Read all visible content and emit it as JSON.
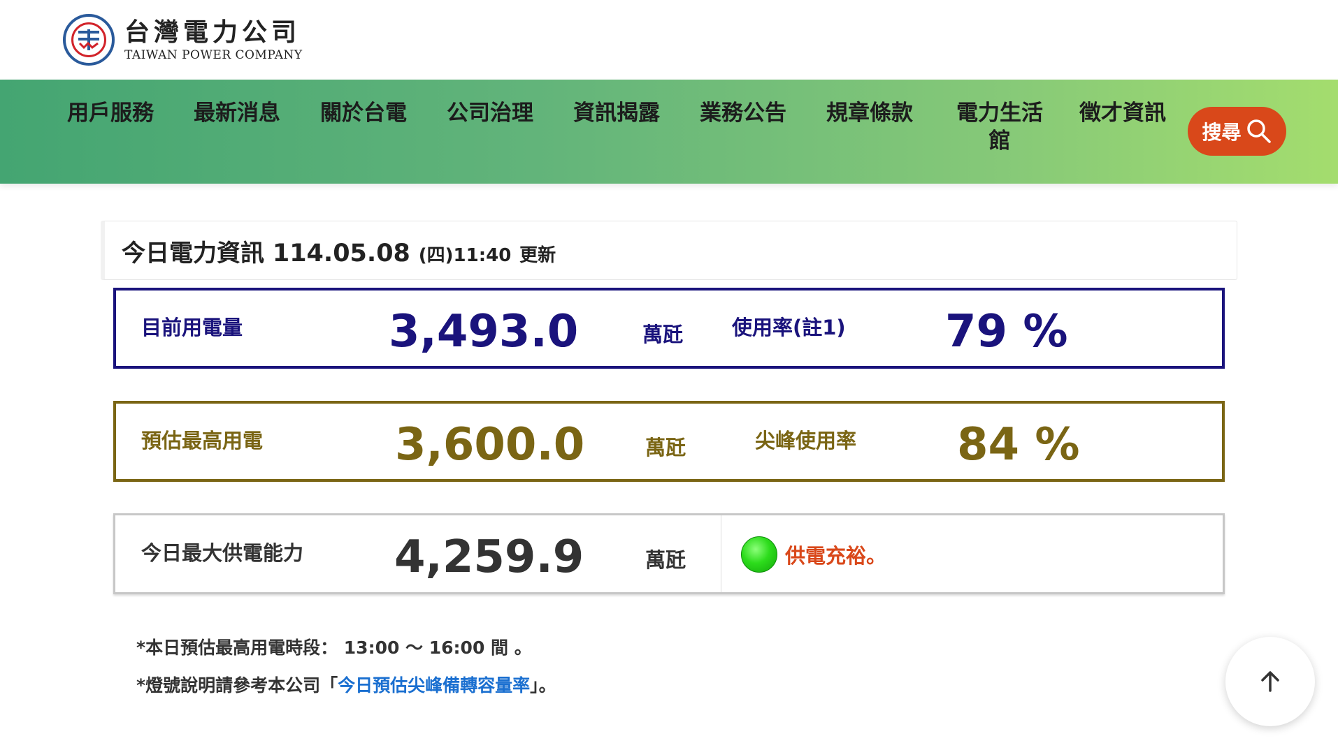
{
  "header": {
    "logo_cn": "台灣電力公司",
    "logo_en": "TAIWAN POWER COMPANY"
  },
  "nav": {
    "items": [
      {
        "label": "用戶服務"
      },
      {
        "label": "最新消息"
      },
      {
        "label": "關於台電"
      },
      {
        "label": "公司治理"
      },
      {
        "label": "資訊揭露"
      },
      {
        "label": "業務公告"
      },
      {
        "label": "規章條款"
      },
      {
        "label": "電力生活館"
      },
      {
        "label": "徵才資訊"
      }
    ],
    "search_label": "搜尋"
  },
  "info": {
    "title": "今日電力資訊",
    "date": "114.05.08",
    "weekday": "(四)",
    "time": "11:40",
    "update_label": "更新"
  },
  "current": {
    "label": "目前用電量",
    "value": "3,493.0",
    "unit": "萬瓩",
    "rate_label": "使用率(註1)",
    "rate_value": "79 %"
  },
  "forecast": {
    "label": "預估最高用電",
    "value": "3,600.0",
    "unit": "萬瓩",
    "rate_label": "尖峰使用率",
    "rate_value": "84 %"
  },
  "capacity": {
    "label": "今日最大供電能力",
    "value": "4,259.9",
    "unit": "萬瓩",
    "status": "供電充裕。",
    "status_color": "#2ddc1c"
  },
  "notes": {
    "note1": "*本日預估最高用電時段： 13:00 ～ 16:00 間 。",
    "note2_prefix": "*燈號說明請參考本公司「",
    "note2_link": "今日預估尖峰備轉容量率",
    "note2_suffix": "」。"
  },
  "colors": {
    "nav_gradient_start": "#44a572",
    "nav_gradient_end": "#a4dd6e",
    "search_button": "#d9481a",
    "current_color": "#1a137c",
    "forecast_color": "#7a6514",
    "link_color": "#1a6fd0"
  },
  "icons": {
    "search": "search-icon",
    "back_to_top": "arrow-up-icon"
  }
}
